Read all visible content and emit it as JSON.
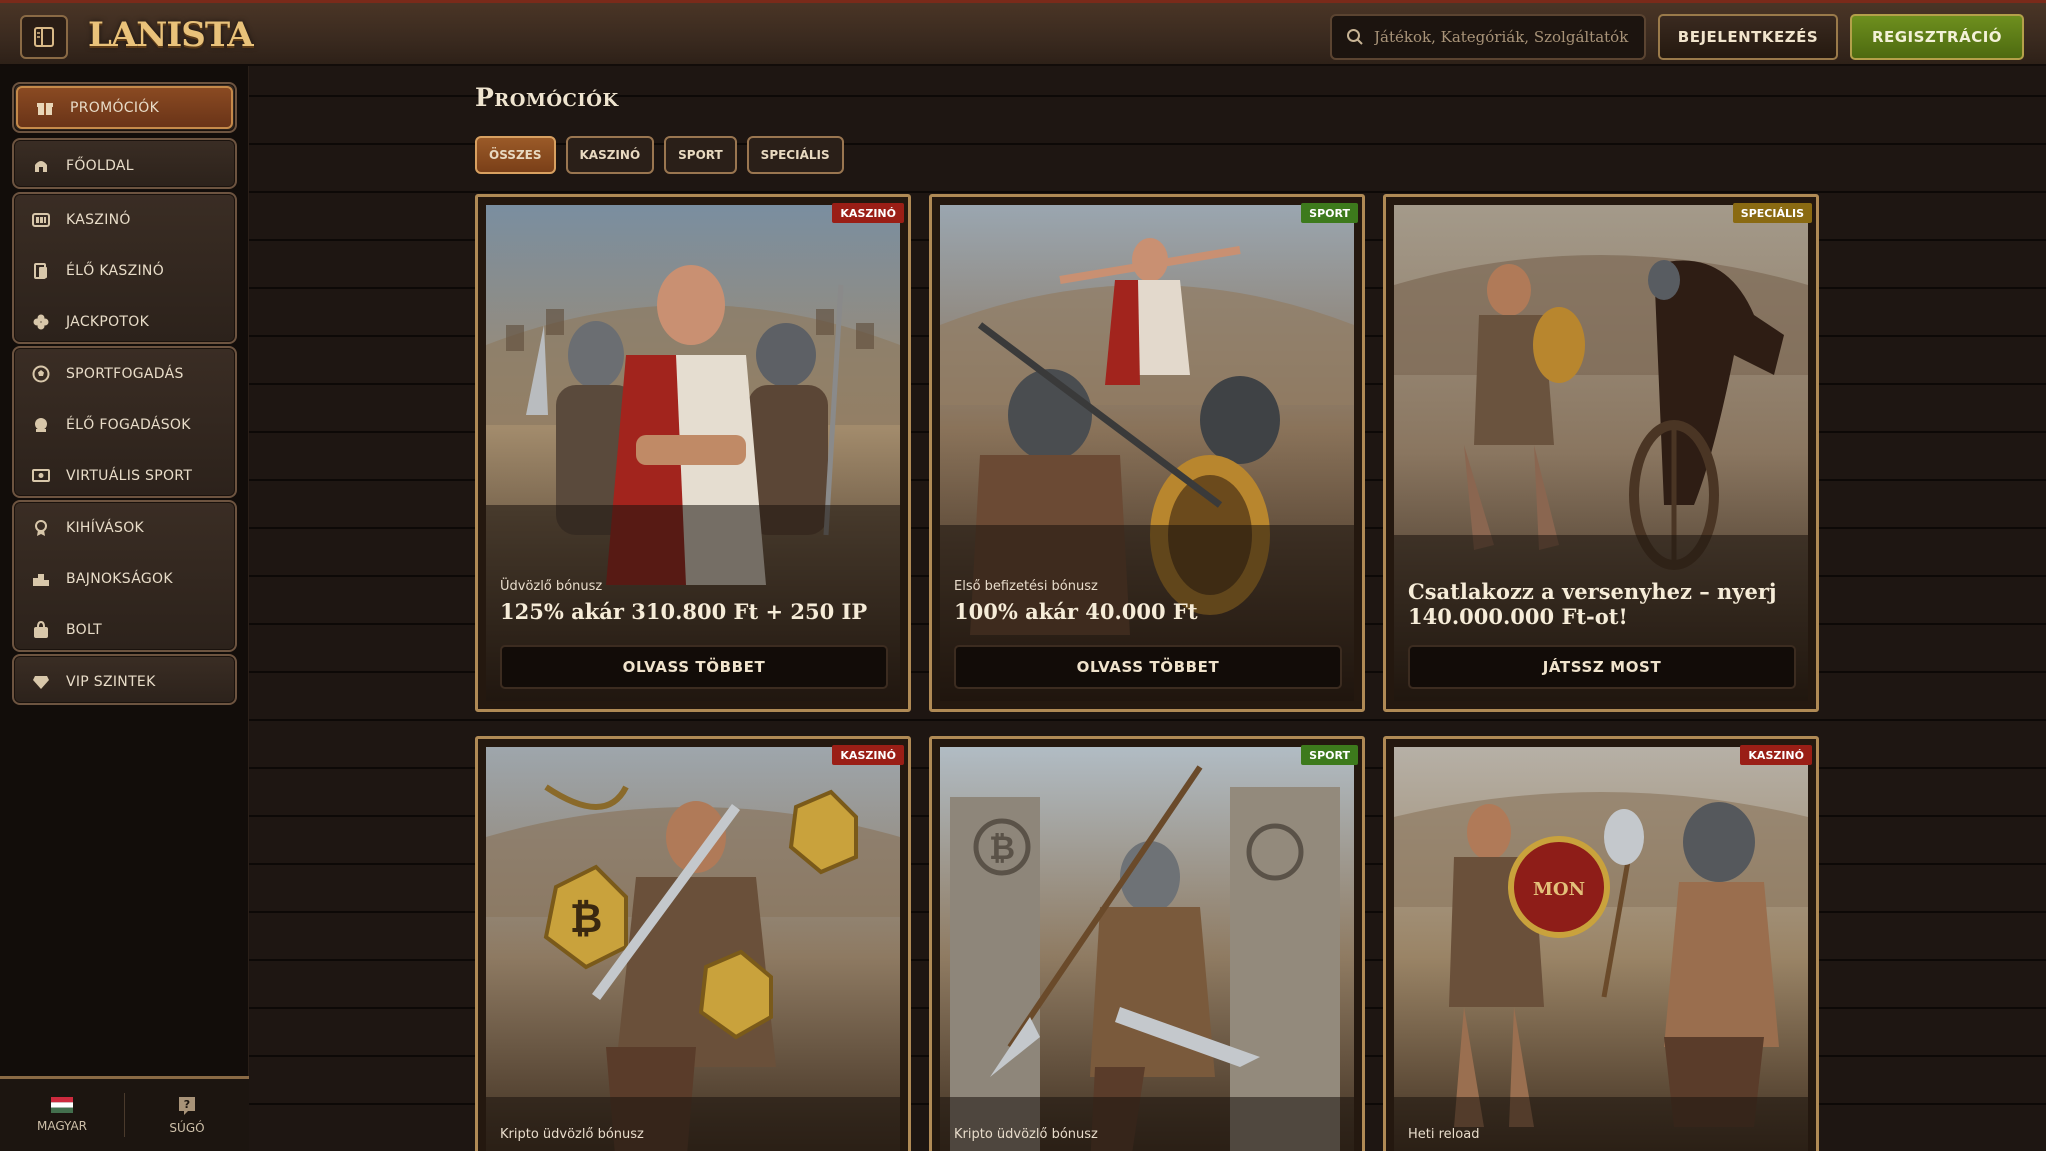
{
  "header": {
    "logo": "LANISTA",
    "search_placeholder": "Játékok, Kategóriák, Szolgáltatók",
    "login_label": "BEJELENTKEZÉS",
    "register_label": "REGISZTRÁCIÓ"
  },
  "sidebar": {
    "items": [
      {
        "label": "PROMÓCIÓK",
        "icon": "gift-icon"
      },
      {
        "label": "FŐOLDAL",
        "icon": "helmet-icon"
      },
      {
        "label": "KASZINÓ",
        "icon": "slot-icon"
      },
      {
        "label": "ÉLŐ KASZINÓ",
        "icon": "cards-icon"
      },
      {
        "label": "JACKPOTOK",
        "icon": "clover-icon"
      },
      {
        "label": "SPORTFOGADÁS",
        "icon": "ball-icon"
      },
      {
        "label": "ÉLŐ FOGADÁSOK",
        "icon": "live-icon"
      },
      {
        "label": "VIRTUÁLIS SPORT",
        "icon": "screen-icon"
      },
      {
        "label": "KIHÍVÁSOK",
        "icon": "medal-icon"
      },
      {
        "label": "BAJNOKSÁGOK",
        "icon": "podium-icon"
      },
      {
        "label": "BOLT",
        "icon": "bag-icon"
      },
      {
        "label": "VIP SZINTEK",
        "icon": "diamond-icon"
      }
    ],
    "footer": {
      "language_label": "MAGYAR",
      "help_label": "SÚGÓ"
    }
  },
  "main": {
    "title": "Promóciók",
    "filters": [
      "ÖSSZES",
      "KASZINÓ",
      "SPORT",
      "SPECIÁLIS"
    ],
    "active_filter": "ÖSSZES",
    "cards": [
      {
        "tag": "KASZINÓ",
        "tag_type": "casino",
        "subtitle": "Üdvözlő bónusz",
        "headline": "125% akár 310.800 Ft + 250 IP",
        "cta": "OLVASS TÖBBET"
      },
      {
        "tag": "SPORT",
        "tag_type": "sport",
        "subtitle": "Első befizetési bónusz",
        "headline": "100% akár 40.000 Ft",
        "cta": "OLVASS TÖBBET"
      },
      {
        "tag": "SPECIÁLIS",
        "tag_type": "special",
        "subtitle": "",
        "headline": "Csatlakozz a versenyhez – nyerj 140.000.000 Ft-ot!",
        "cta": "JÁTSSZ MOST"
      },
      {
        "tag": "KASZINÓ",
        "tag_type": "casino",
        "subtitle": "Kripto üdvözlő bónusz",
        "headline": "",
        "cta": ""
      },
      {
        "tag": "SPORT",
        "tag_type": "sport",
        "subtitle": "Kripto üdvözlő bónusz",
        "headline": "",
        "cta": ""
      },
      {
        "tag": "KASZINÓ",
        "tag_type": "casino",
        "subtitle": "Heti reload",
        "headline": "",
        "cta": ""
      }
    ]
  },
  "colors": {
    "accent_gold": "#b08a55",
    "active_orange": "#8a4a22",
    "register_green": "#6e8f1e",
    "casino_red": "#9a1e16",
    "sport_green": "#3d7a1c",
    "special_gold": "#8a6a12"
  }
}
